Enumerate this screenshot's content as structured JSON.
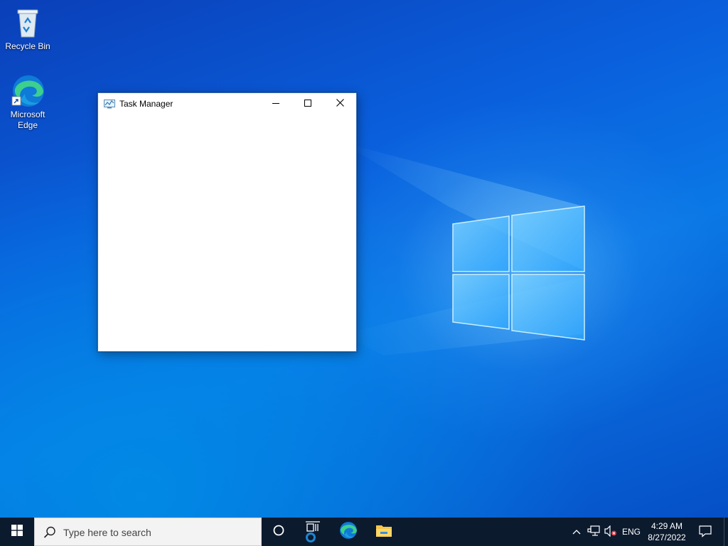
{
  "desktop": {
    "icons": [
      {
        "label": "Recycle Bin",
        "icon": "recycle-bin-icon"
      },
      {
        "label": "Microsoft Edge",
        "icon": "edge-icon"
      }
    ],
    "wallpaper": "windows-10-hero",
    "accent": "#0a78e6"
  },
  "window": {
    "title": "Task Manager",
    "icon": "task-manager-icon",
    "controls": {
      "minimize": "minimize-icon",
      "maximize": "maximize-icon",
      "close": "close-icon"
    }
  },
  "taskbar": {
    "search_placeholder": "Type here to search",
    "pinned": [
      "cortana-icon",
      "task-view-icon",
      "edge-icon",
      "file-explorer-icon"
    ],
    "tray": {
      "language": "ENG",
      "time": "4:29 AM",
      "date": "8/27/2022"
    },
    "color": "#0c1a2e"
  }
}
